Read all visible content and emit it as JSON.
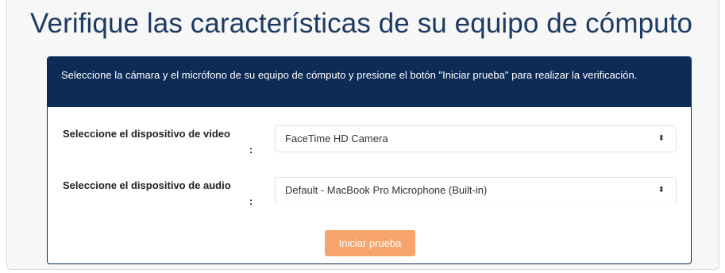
{
  "page": {
    "title": "Verifique las características de su equipo de cómputo"
  },
  "card": {
    "header_text": "Seleccione la cámara y el micrófono de su equipo de cómputo y presione el botón \"Iniciar prueba\" para realizar la verificación.",
    "video": {
      "label": "Seleccione el dispositivo de video",
      "colon": ":",
      "selected": "FaceTime HD Camera"
    },
    "audio": {
      "label": "Seleccione el dispositivo de audio",
      "colon": ":",
      "selected": "Default - MacBook Pro Microphone (Built-in)"
    },
    "start_button": "Iniciar prueba"
  },
  "colors": {
    "title": "#1d3a63",
    "header_bg": "#0d2b57",
    "button_bg": "#f7a46c"
  },
  "icons": {
    "select_caret": "up-down-caret-icon"
  }
}
